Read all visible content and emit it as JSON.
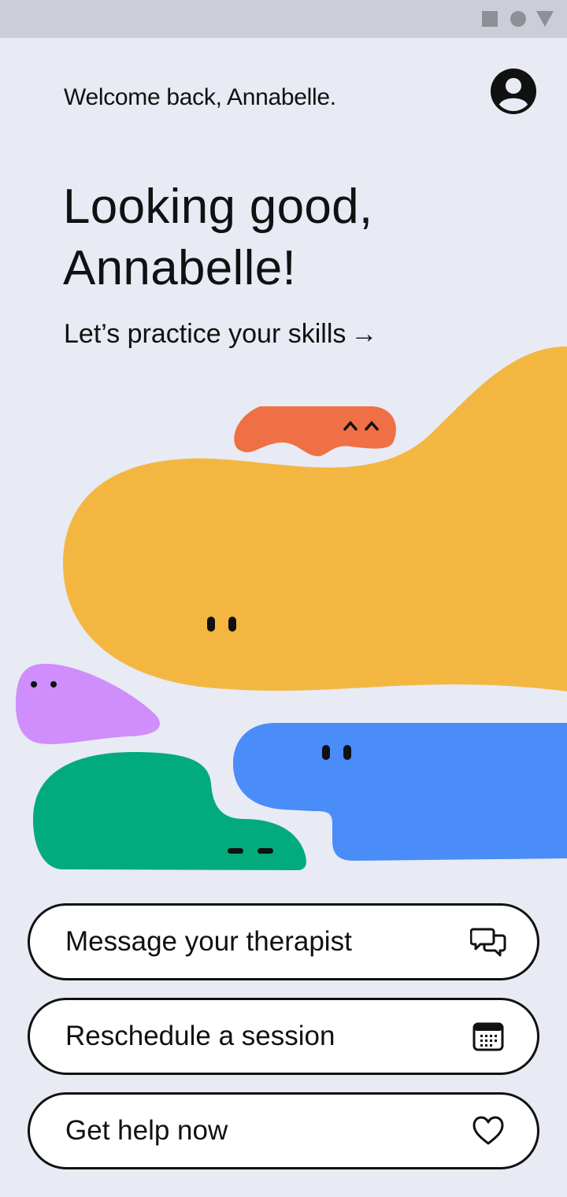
{
  "greeting": "Welcome back, Annabelle.",
  "headline": "Looking good, Annabelle!",
  "practice": {
    "label": "Let’s practice your skills",
    "arrow": "→"
  },
  "actions": [
    {
      "label": "Message your therapist",
      "icon": "chat-bubbles-icon"
    },
    {
      "label": "Reschedule a session",
      "icon": "calendar-icon"
    },
    {
      "label": "Get help now",
      "icon": "heart-icon"
    }
  ],
  "colors": {
    "background": "#e8eaf4",
    "status_bar": "#cbced7",
    "blob_yellow": "#f3b741",
    "blob_orange": "#ef7044",
    "blob_purple": "#cf8efb",
    "blob_green": "#02ab7b",
    "blob_blue": "#4a8cf8"
  }
}
